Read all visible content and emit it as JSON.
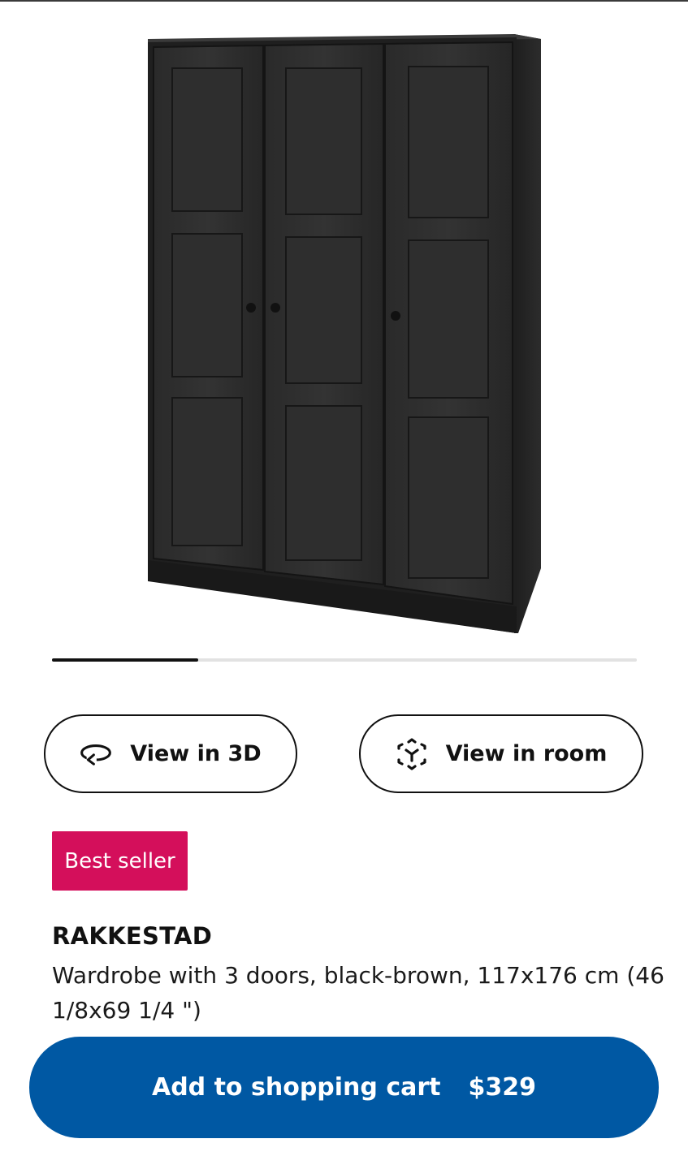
{
  "gallery": {
    "image_icon": "wardrobe-product-image",
    "progress_fraction": 0.25
  },
  "actions": {
    "view_3d_label": "View in 3D",
    "view_3d_icon": "rotate-3d-icon",
    "view_room_label": "View in room",
    "view_room_icon": "ar-cube-icon"
  },
  "badge": {
    "label": "Best seller",
    "color": "#d40f5b"
  },
  "product": {
    "name": "RAKKESTAD",
    "description": "Wardrobe with 3 doors, black-brown, 117x176 cm (46 1/8x69 1/4 \")"
  },
  "cart": {
    "label": "Add to shopping cart",
    "price": "$329",
    "color": "#0058a3"
  }
}
